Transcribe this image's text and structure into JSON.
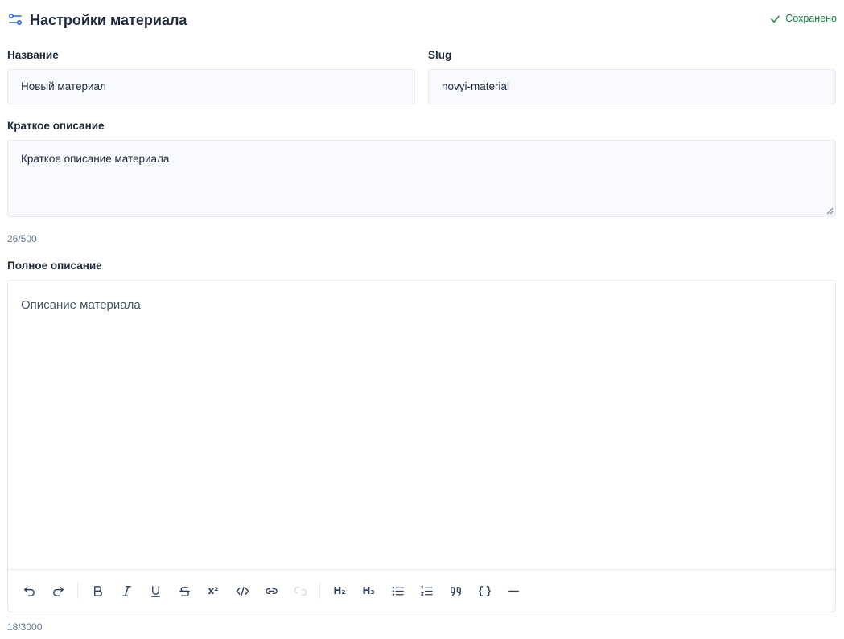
{
  "header": {
    "title": "Настройки материала",
    "icon": "sliders-icon",
    "status_label": "Сохранено",
    "status_icon": "check-icon"
  },
  "fields": {
    "name": {
      "label": "Название",
      "value": "Новый материал"
    },
    "slug": {
      "label": "Slug",
      "value": "novyi-material"
    },
    "short_description": {
      "label": "Краткое описание",
      "value": "Краткое описание материала",
      "counter": "26/500"
    },
    "full_description": {
      "label": "Полное описание",
      "value": "Описание материала",
      "counter": "18/3000"
    }
  },
  "toolbar": {
    "h2": "H₂",
    "h3": "H₃",
    "superscript": "x²",
    "items": [
      "undo-icon",
      "redo-icon",
      "bold-icon",
      "italic-icon",
      "underline-icon",
      "strikethrough-icon",
      "superscript-icon",
      "code-icon",
      "link-icon",
      "unlink-icon",
      "heading-2-icon",
      "heading-3-icon",
      "bullet-list-icon",
      "ordered-list-icon",
      "blockquote-icon",
      "code-block-icon",
      "horizontal-rule-icon"
    ]
  },
  "colors": {
    "accent": "#2563eb",
    "success": "#15803d",
    "input_bg": "#f7f9fc",
    "border": "#e5e9f0"
  }
}
